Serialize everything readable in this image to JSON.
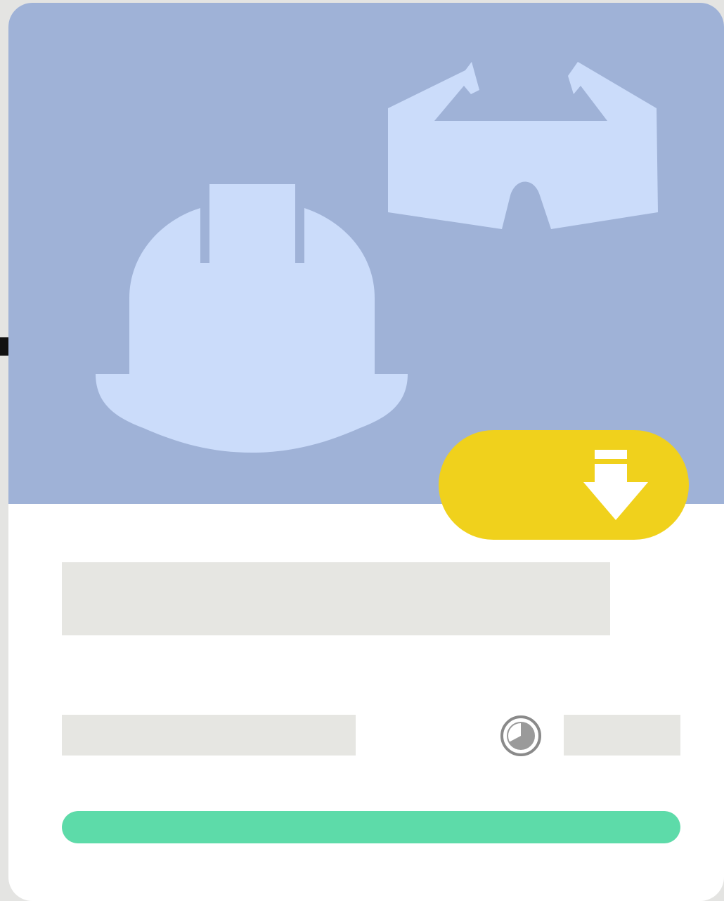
{
  "card": {
    "hero_icons": [
      "hard-hat-icon",
      "safety-goggles-icon"
    ],
    "download_icon": "download-arrow-icon",
    "duration_icon": "clock-icon",
    "progress": 1.0
  },
  "colors": {
    "hero_background": "#9fb2d7",
    "hero_illustration": "#cbdcfa",
    "download_pill": "#f0d11c",
    "download_arrow": "#ffffff",
    "skeleton": "#e6e6e2",
    "progress_fill": "#5ddba9",
    "card_background": "#ffffff"
  }
}
